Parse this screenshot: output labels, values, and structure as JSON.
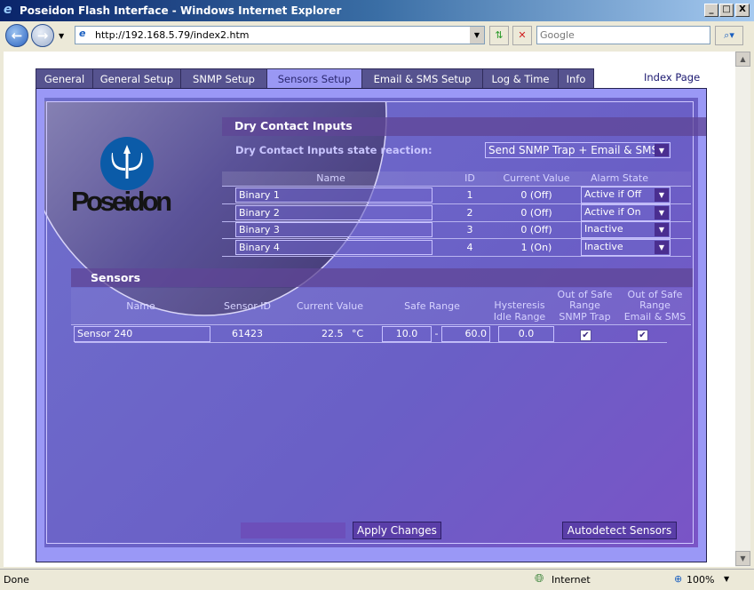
{
  "window": {
    "title": "Poseidon Flash Interface - Windows Internet Explorer",
    "controls": [
      "_",
      "□",
      "X"
    ]
  },
  "toolbar": {
    "url": "http://192.168.5.79/index2.htm",
    "search_placeholder": "Google"
  },
  "tabs": [
    {
      "label": "General"
    },
    {
      "label": "General Setup"
    },
    {
      "label": "SNMP Setup"
    },
    {
      "label": "Sensors Setup",
      "active": true
    },
    {
      "label": "Email & SMS Setup"
    },
    {
      "label": "Log & Time"
    },
    {
      "label": "Info"
    }
  ],
  "index_link": "Index Page",
  "logo": {
    "text": "Poseidon",
    "color": "#0b5ba8"
  },
  "dry": {
    "title": "Dry Contact Inputs",
    "reaction_label": "Dry Contact Inputs state reaction:",
    "reaction_value": "Send SNMP Trap + Email & SMS",
    "headers": [
      "Name",
      "ID",
      "Current Value",
      "Alarm State"
    ],
    "rows": [
      {
        "name": "Binary 1",
        "id": "1",
        "value": "0 (Off)",
        "alarm": "Active if Off"
      },
      {
        "name": "Binary 2",
        "id": "2",
        "value": "0 (Off)",
        "alarm": "Active if On"
      },
      {
        "name": "Binary 3",
        "id": "3",
        "value": "0 (Off)",
        "alarm": "Inactive"
      },
      {
        "name": "Binary 4",
        "id": "4",
        "value": "1 (On)",
        "alarm": "Inactive"
      }
    ]
  },
  "sensors": {
    "title": "Sensors",
    "headers": {
      "name": "Name",
      "id": "Sensor ID",
      "value": "Current Value",
      "range": "Safe Range",
      "hyst1": "Hysteresis",
      "hyst2": "Idle Range",
      "snmp1": "Out of Safe",
      "snmp2": "Range",
      "snmp3": "SNMP Trap",
      "email1": "Out of Safe",
      "email2": "Range",
      "email3": "Email & SMS"
    },
    "rows": [
      {
        "name": "Sensor 240",
        "id": "61423",
        "value": "22.5",
        "unit": "°C",
        "min": "10.0",
        "sep": "-",
        "max": "60.0",
        "hysteresis": "0.0",
        "snmp": true,
        "email": true
      }
    ]
  },
  "buttons": {
    "apply": "Apply Changes",
    "autodetect": "Autodetect Sensors"
  },
  "status": {
    "text": "Done",
    "zone": "Internet",
    "zoom": "100%"
  }
}
